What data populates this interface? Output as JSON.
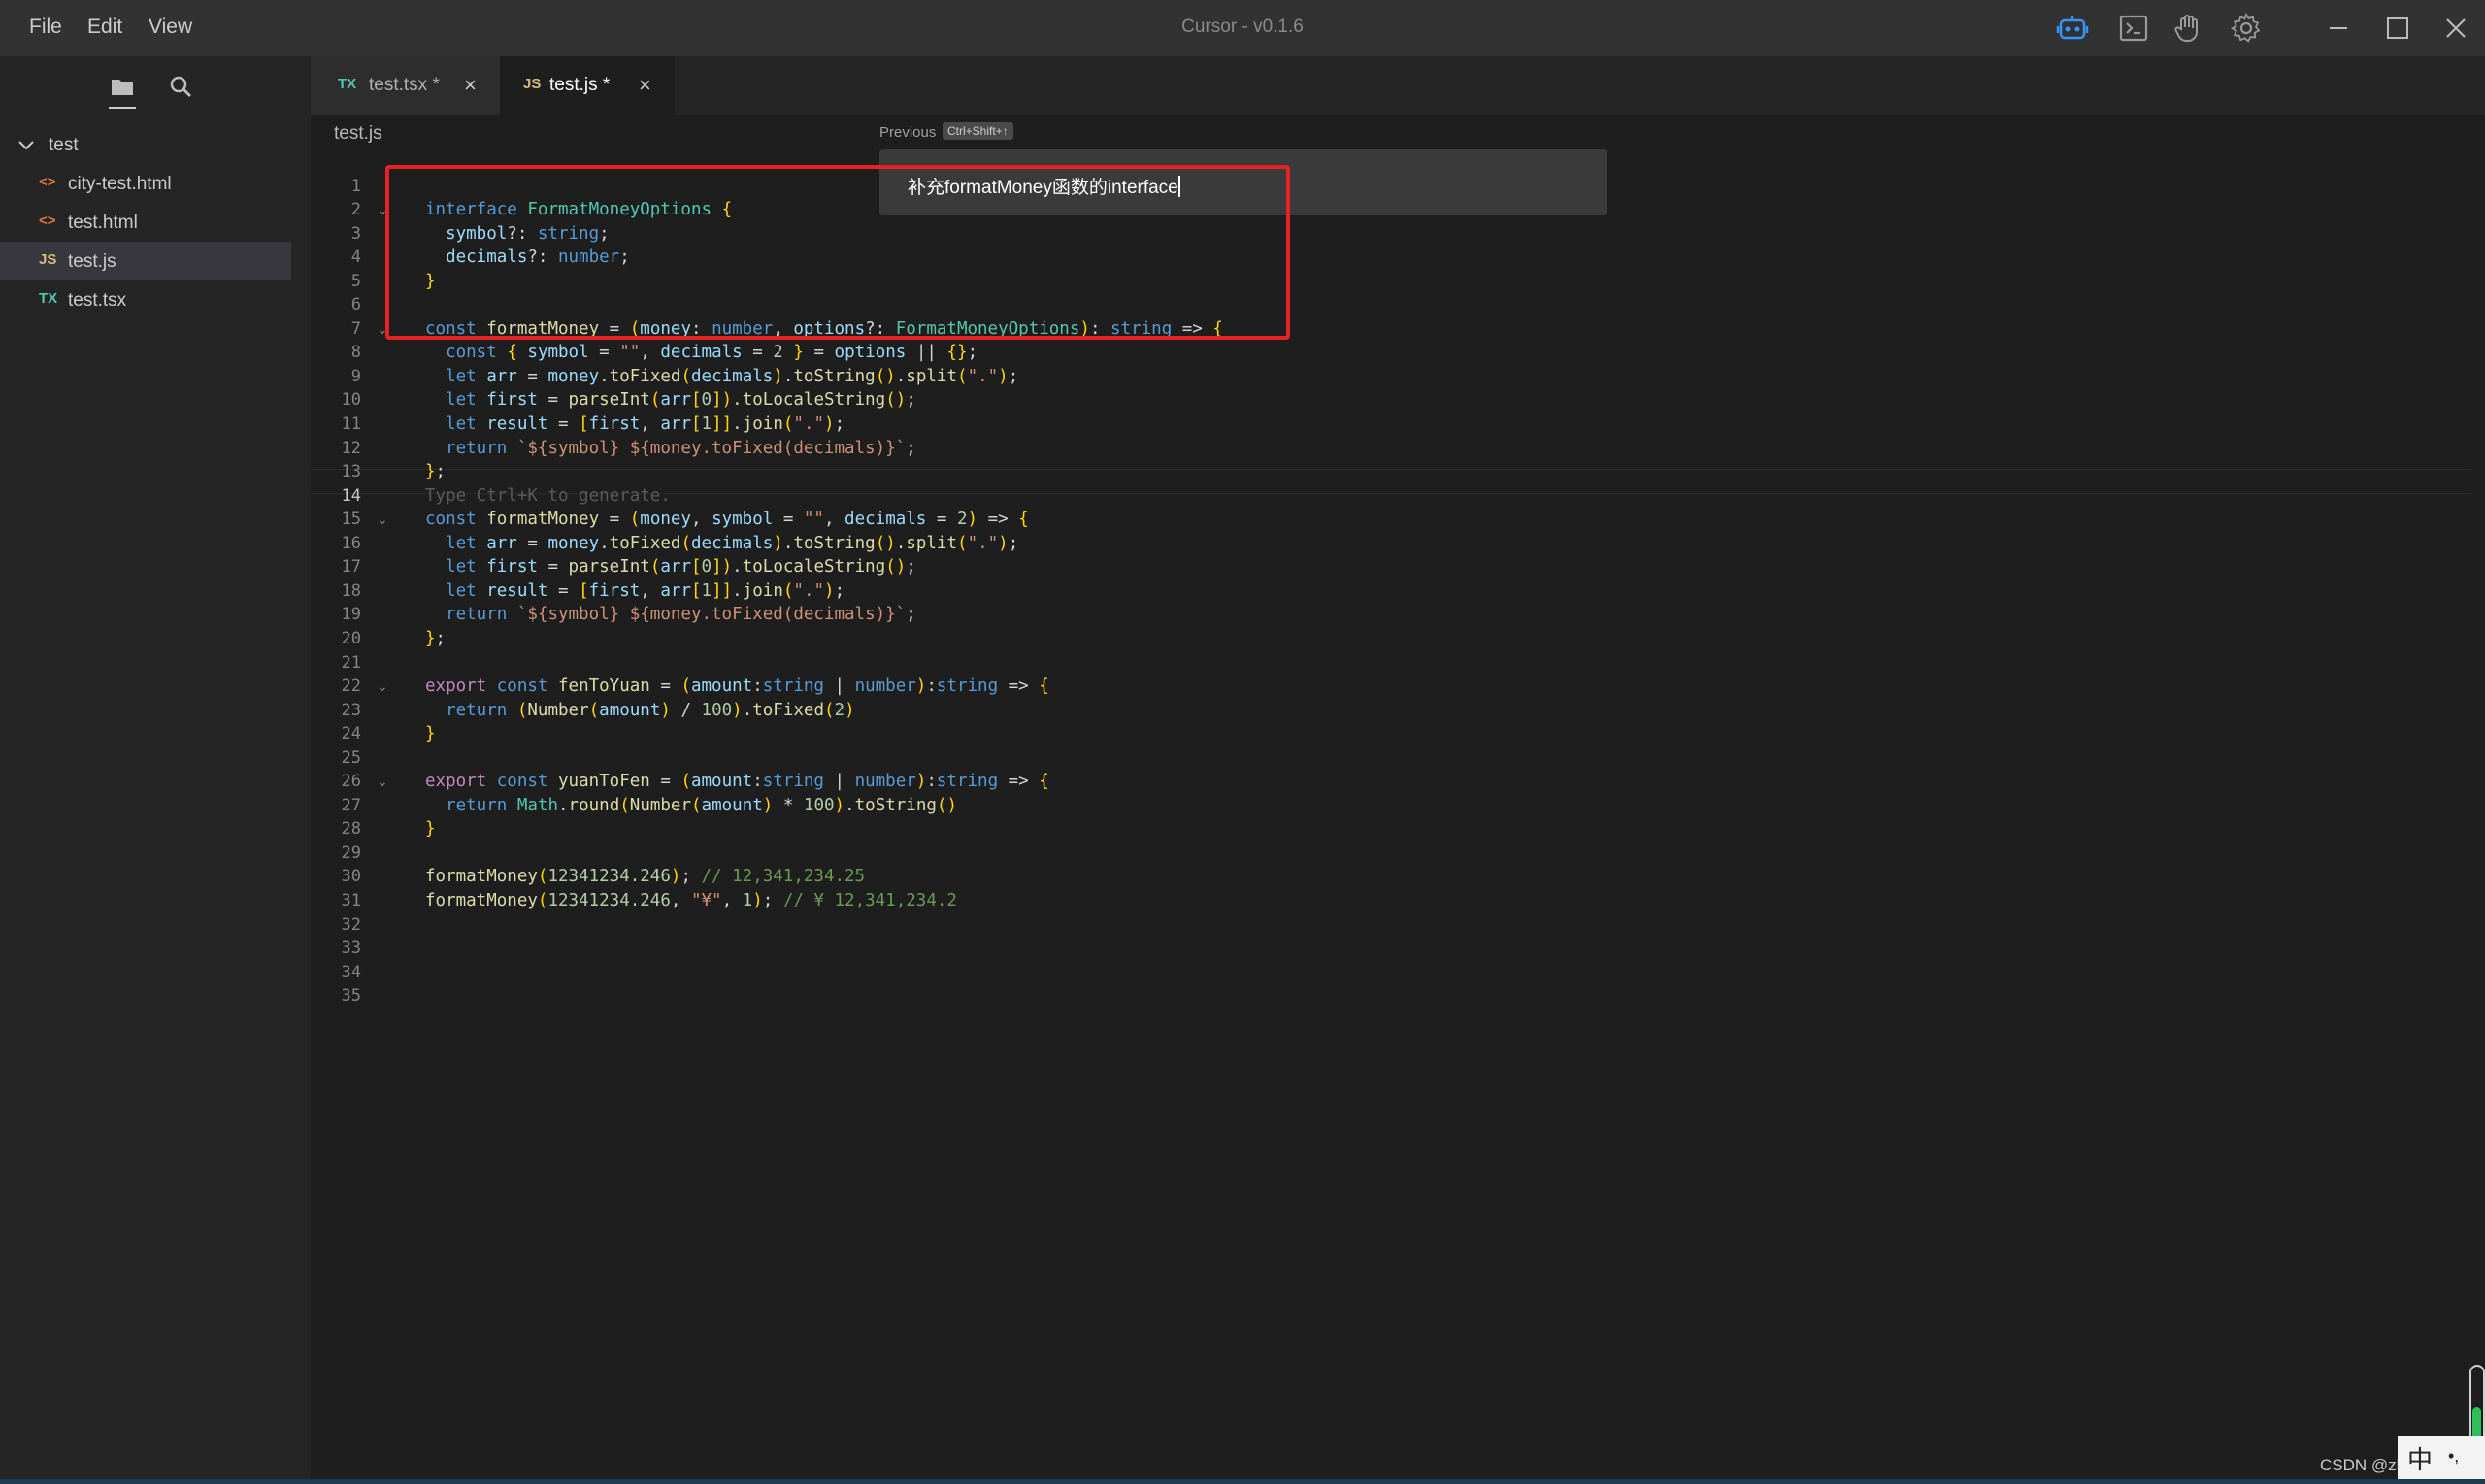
{
  "app": {
    "title": "Cursor - v0.1.6",
    "menu": [
      "File",
      "Edit",
      "View"
    ]
  },
  "toolbar_icons": [
    "robot-icon",
    "terminal-icon",
    "hand-icon",
    "gear-icon"
  ],
  "window_controls": [
    "minimize-icon",
    "maximize-icon",
    "close-icon"
  ],
  "sidebar": {
    "tools": [
      "folder-icon",
      "search-icon"
    ],
    "root": "test",
    "files": [
      {
        "icon": "<>",
        "name": "city-test.html",
        "selected": false
      },
      {
        "icon": "<>",
        "name": "test.html",
        "selected": false
      },
      {
        "icon": "JS",
        "name": "test.js",
        "selected": true
      },
      {
        "icon": "TX",
        "name": "test.tsx",
        "selected": false
      }
    ]
  },
  "tabs": [
    {
      "icon": "TX",
      "label": "test.tsx *",
      "active": false
    },
    {
      "icon": "JS",
      "label": "test.js *",
      "active": true
    }
  ],
  "breadcrumb": "test.js",
  "prompt": {
    "previous_label": "Previous",
    "shortcut": "Ctrl+Shift+↑",
    "text": "补充formatMoney函数的interface"
  },
  "editor": {
    "current_line": 14,
    "line_count": 35,
    "fold_lines": [
      2,
      7,
      15,
      22,
      26
    ],
    "lines": [
      "",
      "interface FormatMoneyOptions {",
      "  symbol?: string;",
      "  decimals?: number;",
      "}",
      "",
      "const formatMoney = (money: number, options?: FormatMoneyOptions): string => {",
      "  const { symbol = \"\", decimals = 2 } = options || {};",
      "  let arr = money.toFixed(decimals).toString().split(\".\");",
      "  let first = parseInt(arr[0]).toLocaleString();",
      "  let result = [first, arr[1]].join(\".\");",
      "  return `${symbol} ${money.toFixed(decimals)}`;",
      "};",
      "Type Ctrl+K to generate.",
      "const formatMoney = (money, symbol = \"\", decimals = 2) => {",
      "  let arr = money.toFixed(decimals).toString().split(\".\");",
      "  let first = parseInt(arr[0]).toLocaleString();",
      "  let result = [first, arr[1]].join(\".\");",
      "  return `${symbol} ${money.toFixed(decimals)}`;",
      "};",
      "",
      "export const fenToYuan = (amount:string | number):string => {",
      "  return (Number(amount) / 100).toFixed(2)",
      "}",
      "",
      "export const yuanToFen = (amount:string | number):string => {",
      "  return Math.round(Number(amount) * 100).toString()",
      "}",
      "",
      "formatMoney(12341234.246); // 12,341,234.25",
      "formatMoney(12341234.246, \"¥\", 1); // ¥ 12,341,234.2",
      "",
      "",
      "",
      ""
    ]
  },
  "watermark": "CSDN @zhichaosong",
  "ime": [
    "中",
    "•,"
  ]
}
